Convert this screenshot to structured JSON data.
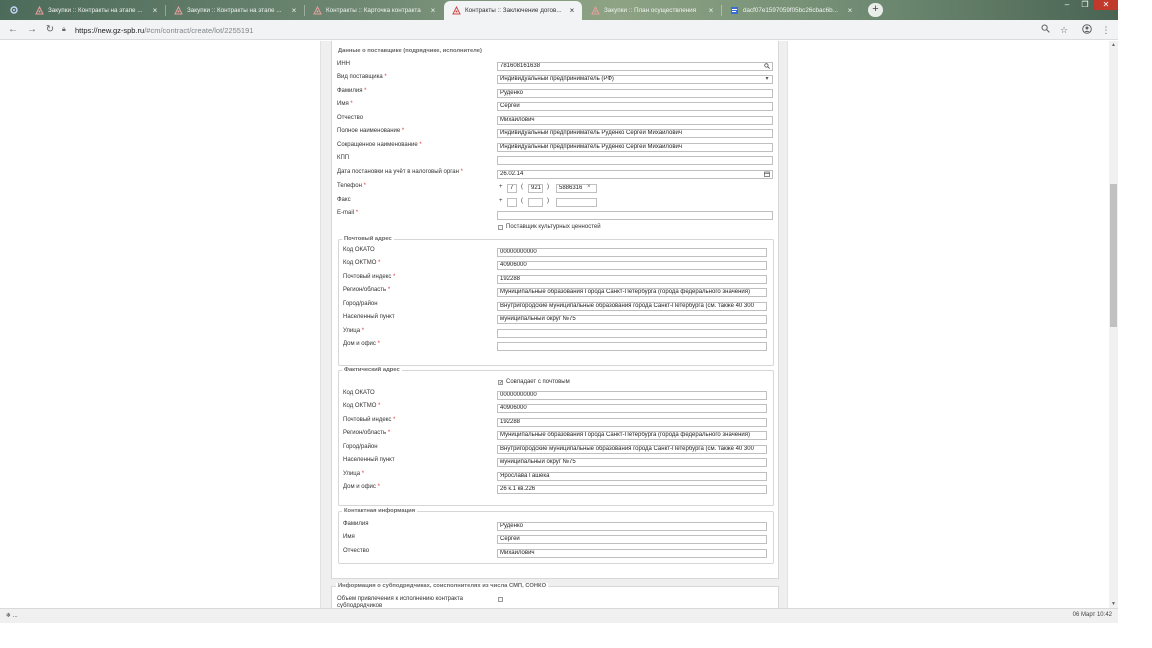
{
  "browser": {
    "tabs": [
      {
        "title": "Закупки :: Контракты на этапе ...",
        "active": false,
        "icon": "gz-icon"
      },
      {
        "title": "Закупки :: Контракты на этапе ...",
        "active": false,
        "icon": "gz-icon"
      },
      {
        "title": "Контракты :: Карточка контракта",
        "active": false,
        "icon": "gz-icon"
      },
      {
        "title": "Контракты :: Заключение догов...",
        "active": true,
        "icon": "gz-icon"
      },
      {
        "title": "Закупки :: План осуществления",
        "active": false,
        "icon": "gz-icon"
      },
      {
        "title": "dacf07e1597059f05bc26cbac6b...",
        "active": false,
        "icon": "doc-icon"
      }
    ],
    "close_glyph": "×",
    "new_tab_glyph": "+",
    "url_host": "https://new.gz-spb.ru",
    "url_path": "/#cm/contract/create/lot/2255191"
  },
  "form": {
    "supplier_legend": "Данные о поставщике (подрядчике, исполнителе)",
    "fields": {
      "inn": {
        "label": "ИНН",
        "value": "781608161638"
      },
      "supplier_type": {
        "label": "Вид поставщика",
        "value": "Индивидуальный предприниматель (РФ)"
      },
      "last_name": {
        "label": "Фамилия",
        "value": "Руденко"
      },
      "first_name": {
        "label": "Имя",
        "value": "Сергей"
      },
      "patronymic": {
        "label": "Отчество",
        "value": "Михайлович"
      },
      "full_name": {
        "label": "Полное наименование",
        "value": "Индивидуальный предприниматель Руденко Сергей Михайлович"
      },
      "short_name": {
        "label": "Сокращенное наименование",
        "value": "Индивидуальный предприниматель Руденко Сергей Михайлович"
      },
      "kpp": {
        "label": "КПП",
        "value": ""
      },
      "tax_date": {
        "label": "Дата постановки на учёт в налоговый орган",
        "value": "26.02.14"
      },
      "phone": {
        "label": "Телефон",
        "plus": "+",
        "country": "7",
        "area": "921",
        "number": "5886316",
        "clear": "×"
      },
      "fax": {
        "label": "Факс",
        "plus": "+",
        "country": "",
        "area": "",
        "number": ""
      },
      "email": {
        "label": "E-mail",
        "value": ""
      },
      "culture_checkbox": {
        "label": "Поставщик культурных ценностей",
        "checked": false
      }
    },
    "postal": {
      "legend": "Почтовый адрес",
      "okato": {
        "label": "Код ОКАТО",
        "value": "00000000000"
      },
      "oktmo": {
        "label": "Код ОКТМО",
        "value": "40906000"
      },
      "zip": {
        "label": "Почтовый индекс",
        "value": "192288"
      },
      "region": {
        "label": "Регион/область",
        "value": "Муниципальные образования  Города Санкт-Петербурга (города федерального значения)"
      },
      "city": {
        "label": "Город/район",
        "value": "Внутригородские муниципальные образования  города Санкт-Петербурга (см. также 40 300"
      },
      "settlement": {
        "label": "Населенный пункт",
        "value": "муниципальный округ №75"
      },
      "street": {
        "label": "Улица",
        "value": ""
      },
      "house": {
        "label": "Дом и офис",
        "value": ""
      }
    },
    "actual": {
      "legend": "Фактический адрес",
      "same_checkbox": {
        "label": "Совпадает с почтовым",
        "checked": true
      },
      "okato": {
        "label": "Код ОКАТО",
        "value": "00000000000"
      },
      "oktmo": {
        "label": "Код ОКТМО",
        "value": "40906000"
      },
      "zip": {
        "label": "Почтовый индекс",
        "value": "192288"
      },
      "region": {
        "label": "Регион/область",
        "value": "Муниципальные образования  Города Санкт-Петербурга (города федерального значения)"
      },
      "city": {
        "label": "Город/район",
        "value": "Внутригородские муниципальные образования  города Санкт-Петербурга (см. также 40 300"
      },
      "settlement": {
        "label": "Населенный пункт",
        "value": "муниципальный округ №75"
      },
      "street": {
        "label": "Улица",
        "value": "Ярослава Гашека"
      },
      "house": {
        "label": "Дом и офис",
        "value": "26 к.1 кв.226"
      }
    },
    "contact": {
      "legend": "Контактная информация",
      "last_name": {
        "label": "Фамилия",
        "value": "Руденко"
      },
      "first_name": {
        "label": "Имя",
        "value": "Сергей"
      },
      "patronymic": {
        "label": "Отчество",
        "value": "Михайлович"
      }
    },
    "subcontract": {
      "legend": "Информация о субподрядчиках, соисполнителях из числа СМП, СОНКО",
      "volume_label_1": "Объем привлечения к исполнению контракта",
      "volume_label_2": "субподрядчиков"
    },
    "required_mark": "*"
  },
  "statusbar": {
    "left": "❄ ...",
    "right": "06 Март 10:42"
  }
}
